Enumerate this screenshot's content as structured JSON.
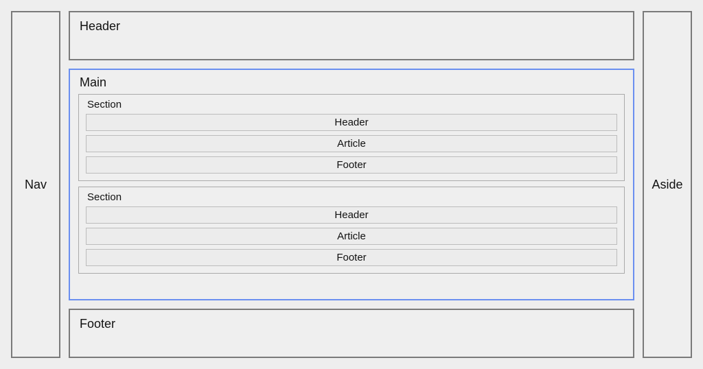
{
  "nav": {
    "label": "Nav"
  },
  "aside": {
    "label": "Aside"
  },
  "header": {
    "label": "Header"
  },
  "footer": {
    "label": "Footer"
  },
  "main": {
    "label": "Main",
    "sections": [
      {
        "label": "Section",
        "rows": {
          "header": "Header",
          "article": "Article",
          "footer": "Footer"
        }
      },
      {
        "label": "Section",
        "rows": {
          "header": "Header",
          "article": "Article",
          "footer": "Footer"
        }
      }
    ]
  }
}
